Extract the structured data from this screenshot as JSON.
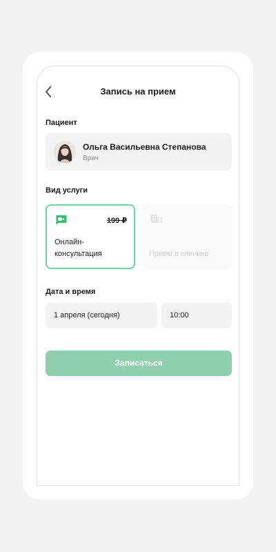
{
  "header": {
    "title": "Запись на прием",
    "back_icon": "chevron-left-icon"
  },
  "patient": {
    "section_label": "Пациент",
    "name": "Ольга Васильевна Степанова",
    "role": "Врач"
  },
  "service": {
    "section_label": "Вид услуги",
    "options": [
      {
        "icon": "video-chat-icon",
        "price": "199 ₽",
        "label": "Онлайн-консультация",
        "selected": true
      },
      {
        "icon": "clinic-building-icon",
        "label": "Прием в клинике",
        "selected": false
      }
    ]
  },
  "datetime": {
    "section_label": "Дата и время",
    "date": "1 апреля (сегодня)",
    "time": "10:00"
  },
  "submit_label": "Записаться",
  "colors": {
    "accent": "#71d49c",
    "button": "#90d0b0",
    "field_bg": "#f3f3f3",
    "disabled_text": "#cfcfcf"
  }
}
